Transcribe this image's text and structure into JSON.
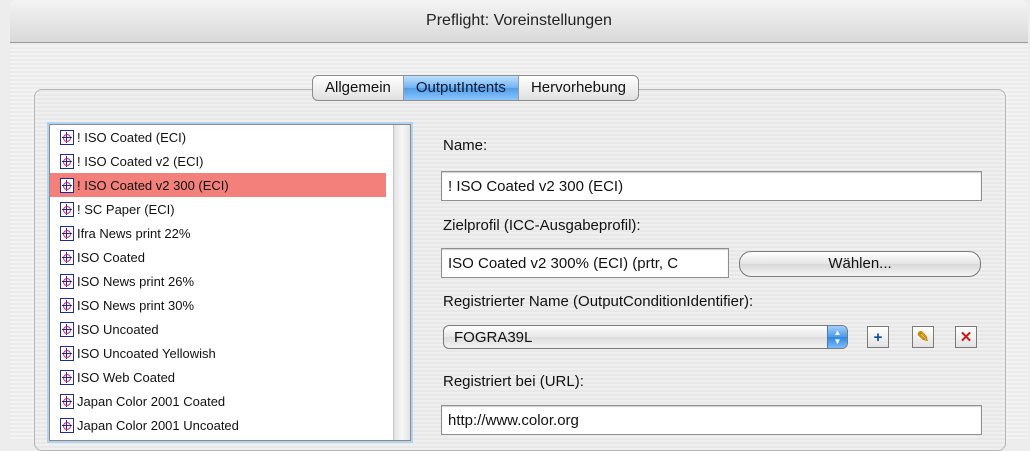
{
  "window": {
    "title": "Preflight: Voreinstellungen"
  },
  "tabs": [
    {
      "label": "Allgemein"
    },
    {
      "label": "OutputIntents",
      "active": true
    },
    {
      "label": "Hervorhebung"
    }
  ],
  "profiles": [
    {
      "label": "! ISO Coated (ECI)"
    },
    {
      "label": "! ISO Coated v2 (ECI)"
    },
    {
      "label": "! ISO Coated v2 300 (ECI)",
      "selected": true
    },
    {
      "label": "! SC Paper (ECI)"
    },
    {
      "label": "Ifra News print 22%"
    },
    {
      "label": "ISO Coated"
    },
    {
      "label": "ISO News print 26%"
    },
    {
      "label": "ISO News print 30%"
    },
    {
      "label": "ISO Uncoated"
    },
    {
      "label": "ISO Uncoated Yellowish"
    },
    {
      "label": "ISO Web Coated"
    },
    {
      "label": "Japan Color 2001 Coated"
    },
    {
      "label": "Japan Color 2001 Uncoated"
    }
  ],
  "form": {
    "name_label": "Name:",
    "name_value": "! ISO Coated v2 300 (ECI)",
    "profile_label": "Zielprofil (ICC-Ausgabeprofil):",
    "profile_value": "ISO Coated v2 300% (ECI) (prtr, C",
    "choose_button": "Wählen...",
    "registered_label": "Registrierter Name (OutputConditionIdentifier):",
    "registered_value": "FOGRA39L",
    "registered_at_label": "Registriert bei (URL):",
    "registered_at_value": "http://www.color.org"
  },
  "icons": {
    "profile": "icc-profile-icon",
    "add": "add-icon",
    "edit": "pencil-icon",
    "delete": "delete-icon"
  },
  "colors": {
    "selection": "#f3807a",
    "active_tab": "#4f9de8"
  }
}
